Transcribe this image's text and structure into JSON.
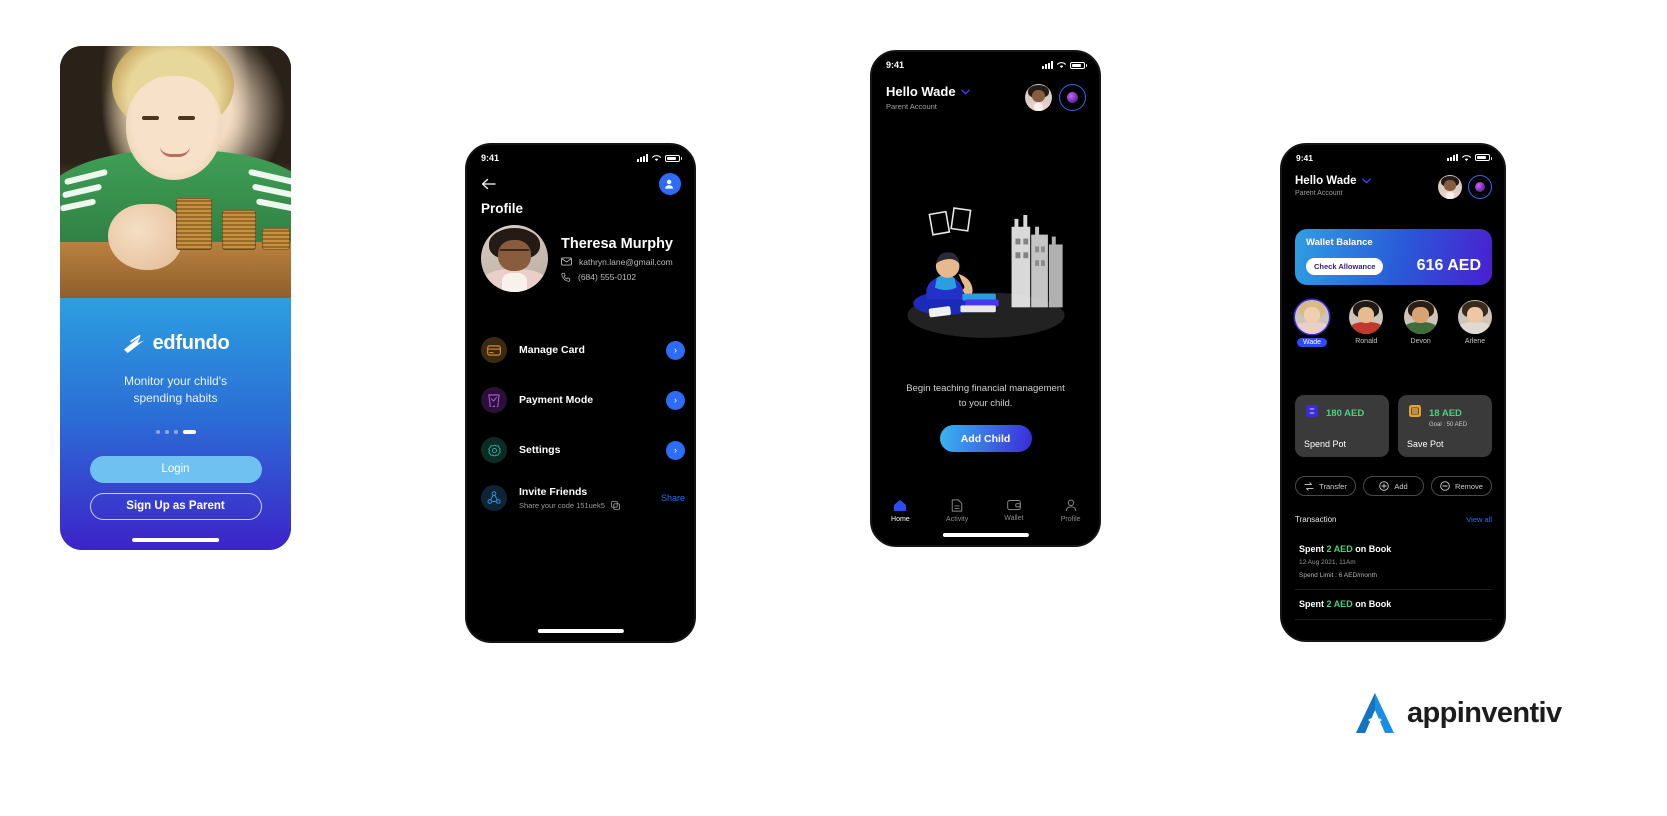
{
  "screen1": {
    "name": "onboarding-splash",
    "brand": "edfundo",
    "tagline": "Monitor your child's\nspending habits",
    "dots": 4,
    "active_dot": 4,
    "login_label": "Login",
    "signup_label": "Sign Up as Parent",
    "colors": {
      "top": "#2d9fe0",
      "bottom": "#3d23c9",
      "login_bg": "#6ec1f0"
    }
  },
  "screen2": {
    "name": "profile",
    "status": {
      "time": "9:41"
    },
    "back_icon": "arrow-left-icon",
    "add_icon": "add-person-icon",
    "title": "Profile",
    "user": {
      "name": "Theresa Murphy",
      "email": "kathryn.lane@gmail.com",
      "phone": "(684) 555-0102"
    },
    "menu": [
      {
        "label": "Manage Card",
        "icon": "credit-card-icon"
      },
      {
        "label": "Payment Mode",
        "icon": "payment-mode-icon"
      },
      {
        "label": "Settings",
        "icon": "gear-icon"
      }
    ],
    "invite": {
      "label": "Invite Friends",
      "sub": "Share your code 151uek5",
      "copy_icon": "copy-icon",
      "action": "Share"
    }
  },
  "screen3": {
    "name": "home-empty-state",
    "status": {
      "time": "9:41"
    },
    "greeting": "Hello Wade",
    "account_type": "Parent Account",
    "chevron_icon": "chevron-down-icon",
    "empty_text": "Begin teaching financial management\nto your child.",
    "cta_label": "Add Child",
    "nav": [
      {
        "label": "Home",
        "icon": "home-icon",
        "active": true
      },
      {
        "label": "Activity",
        "icon": "document-icon",
        "active": false
      },
      {
        "label": "Wallet",
        "icon": "wallet-icon",
        "active": false
      },
      {
        "label": "Profile",
        "icon": "person-icon",
        "active": false
      }
    ]
  },
  "screen4": {
    "name": "wallet-dashboard",
    "status": {
      "time": "9:41"
    },
    "greeting": "Hello Wade",
    "account_type": "Parent Account",
    "wallet": {
      "title": "Wallet Balance",
      "button_label": "Check Allowance",
      "amount": "616 AED"
    },
    "kids": [
      {
        "name": "Wade",
        "selected": true
      },
      {
        "name": "Ronald",
        "selected": false
      },
      {
        "name": "Devon",
        "selected": false
      },
      {
        "name": "Arlene",
        "selected": false
      }
    ],
    "pots": [
      {
        "label": "Spend Pot",
        "amount": "180 AED",
        "goal": "",
        "icon": "spend-pot-icon"
      },
      {
        "label": "Save Pot",
        "amount": "18 AED",
        "goal": "Goal : 50 AED",
        "icon": "save-pot-icon"
      }
    ],
    "actions": [
      {
        "label": "Transfer",
        "icon": "transfer-icon"
      },
      {
        "label": "Add",
        "icon": "plus-circle-icon"
      },
      {
        "label": "Remove",
        "icon": "minus-circle-icon"
      }
    ],
    "transactions_title": "Transaction",
    "view_all_label": "View all",
    "transactions": [
      {
        "prefix": "Spent ",
        "amount": "2 AED",
        "suffix": " on Book",
        "date": "12 Aug 2021, 11Am",
        "limit": "Spend Limit : 6 AED/month"
      },
      {
        "prefix": "Spent ",
        "amount": "2 AED",
        "suffix": " on Book",
        "date": "",
        "limit": ""
      }
    ]
  },
  "footer": {
    "logo_text": "appinventiv",
    "logo_icon": "appinventiv-logo-icon",
    "accent": "#1a8fe3"
  }
}
